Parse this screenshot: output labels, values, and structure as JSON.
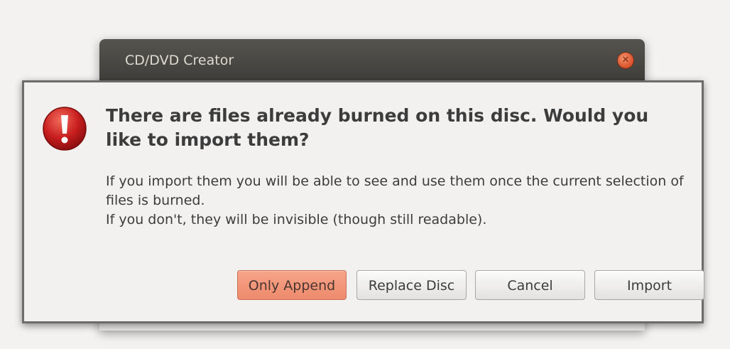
{
  "window": {
    "title": "CD/DVD Creator",
    "close_icon": "close-icon"
  },
  "dialog": {
    "icon": "warning-icon",
    "headline": "There are files already burned on this disc. Would you like to import them?",
    "body_line_1": "If you import them you will be able to see and use them once the current selection of files is burned.",
    "body_line_2": "If you don't, they will be invisible (though still readable).",
    "buttons": {
      "only_append": "Only Append",
      "replace_disc": "Replace Disc",
      "cancel": "Cancel",
      "import": "Import"
    }
  },
  "colors": {
    "titlebar": "#45443f",
    "default_button": "#ee8a6c",
    "warning_icon": "#c81e1e",
    "close_button": "#e35d32"
  }
}
